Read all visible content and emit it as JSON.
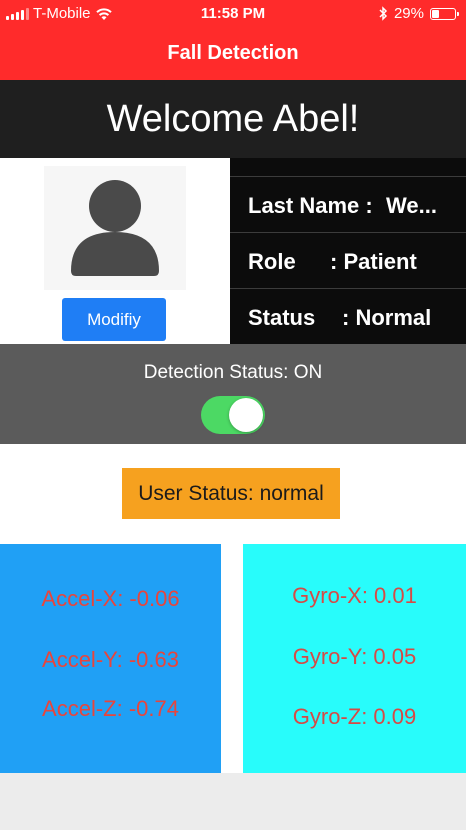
{
  "status_bar": {
    "carrier": "T-Mobile",
    "time": "11:58 PM",
    "battery": "29%",
    "battery_level": 0.29,
    "icons": [
      "signal-icon",
      "wifi-icon",
      "bluetooth-icon",
      "battery-icon"
    ]
  },
  "nav": {
    "title": "Fall Detection"
  },
  "welcome": {
    "text": "Welcome Abel!"
  },
  "profile": {
    "avatar_icon": "user-avatar-icon",
    "modify_label": "Modifiy",
    "info": [
      {
        "label": "Last Name :",
        "value": "We..."
      },
      {
        "label": "Role",
        "value": ": Patient"
      },
      {
        "label": "Status",
        "value": ": Normal"
      }
    ]
  },
  "detection": {
    "label": "Detection Status: ON",
    "enabled": true
  },
  "user_status": {
    "text": "User Status: normal"
  },
  "accel": {
    "x": "Accel-X: -0.06",
    "y": "Accel-Y: -0.63",
    "z": "Accel-Z: -0.74"
  },
  "gyro": {
    "x": "Gyro-X: 0.01",
    "y": "Gyro-Y: 0.05",
    "z": "Gyro-Z: 0.09"
  },
  "colors": {
    "header_red": "#ff2b2b",
    "welcome_bg": "#1f1f1f",
    "button_blue": "#1f7ef5",
    "toggle_green": "#4cd964",
    "status_orange": "#f6a11f",
    "accel_blue": "#20a0f5",
    "gyro_cyan": "#28fcfb",
    "reading_red": "#e8453c"
  }
}
